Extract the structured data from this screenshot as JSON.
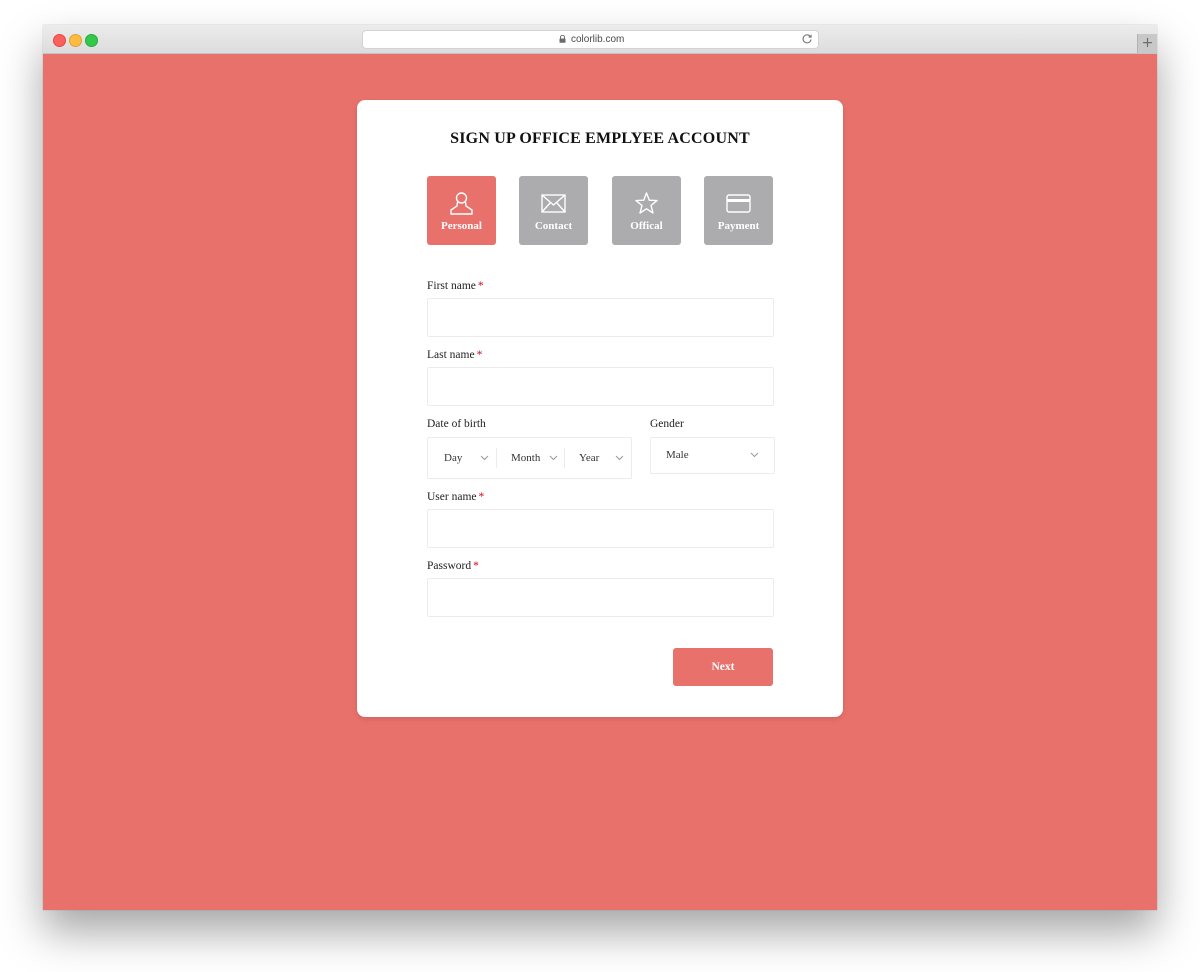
{
  "browser": {
    "url": "colorlib.com",
    "new_tab_symbol": "+"
  },
  "form": {
    "title": "SIGN UP OFFICE EMPLYEE ACCOUNT",
    "steps": [
      {
        "label": "Personal",
        "icon": "user-icon",
        "active": true
      },
      {
        "label": "Contact",
        "icon": "envelope-icon",
        "active": false
      },
      {
        "label": "Offical",
        "icon": "star-icon",
        "active": false
      },
      {
        "label": "Payment",
        "icon": "credit-card-icon",
        "active": false
      }
    ],
    "first_name": {
      "label": "First name",
      "required_mark": "*",
      "value": ""
    },
    "last_name": {
      "label": "Last name",
      "required_mark": "*",
      "value": ""
    },
    "date_of_birth": {
      "label": "Date of birth",
      "day": "Day",
      "month": "Month",
      "year": "Year"
    },
    "gender": {
      "label": "Gender",
      "value": "Male"
    },
    "user_name": {
      "label": "User name",
      "required_mark": "*",
      "value": ""
    },
    "password": {
      "label": "Password",
      "required_mark": "*",
      "value": ""
    },
    "next_label": "Next"
  },
  "colors": {
    "accent": "#e9716c",
    "inactive_step": "#acacae",
    "required": "#d0021b"
  }
}
